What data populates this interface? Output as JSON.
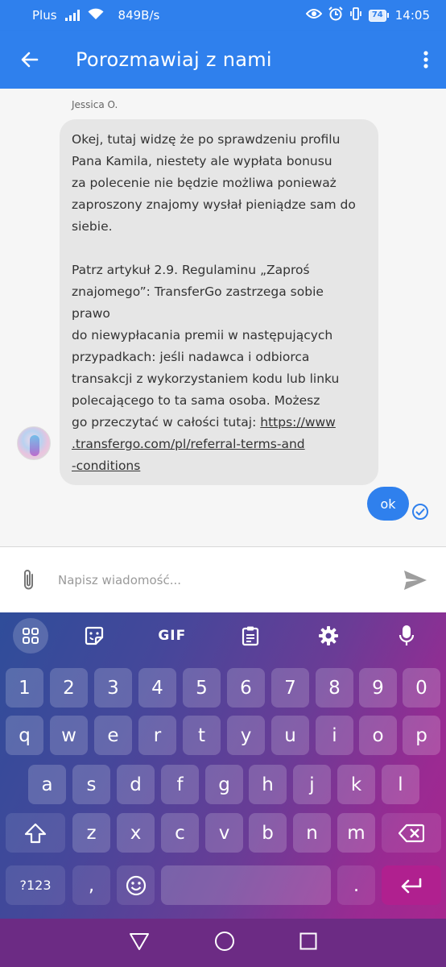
{
  "status_bar": {
    "carrier": "Plus",
    "speed": "849B/s",
    "battery": "74",
    "time": "14:05"
  },
  "app_bar": {
    "title": "Porozmawiaj z nami"
  },
  "chat": {
    "agent_name": "Jessica O.",
    "agent_message": "Okej, tutaj widzę że po sprawdzeniu profilu\nPana Kamila, niestety ale wypłata bonusu\nza polecenie nie będzie możliwa ponieważ\nzaproszony znajomy wysłał pieniądze sam do\nsiebie.\n\nPatrz artykuł 2.9. Regulaminu „Zaproś\nznajomego”: TransferGo zastrzega sobie prawo\ndo niewypłacania premii w następujących\nprzypadkach: jeśli nadawca i odbiorca\ntransakcji z wykorzystaniem kodu lub linku\npolecającego to ta sama osoba. Możesz\ngo przeczytać w całości tutaj: ",
    "agent_link": "https://www\n.transfergo.com/pl/referral-terms-and\n-conditions",
    "user_message": "ok"
  },
  "composer": {
    "placeholder": "Napisz wiadomość..."
  },
  "keyboard": {
    "toolbar": {
      "gif_label": "GIF"
    },
    "number_row": [
      "1",
      "2",
      "3",
      "4",
      "5",
      "6",
      "7",
      "8",
      "9",
      "0"
    ],
    "row1": [
      "q",
      "w",
      "e",
      "r",
      "t",
      "y",
      "u",
      "i",
      "o",
      "p"
    ],
    "row2": [
      "a",
      "s",
      "d",
      "f",
      "g",
      "h",
      "j",
      "k",
      "l"
    ],
    "row3": [
      "z",
      "x",
      "c",
      "v",
      "b",
      "n",
      "m"
    ],
    "bottom": {
      "symbols_label": "?123",
      "comma": ",",
      "period": "."
    }
  },
  "colors": {
    "primary": "#2f80ed",
    "bubble_incoming": "#e6e6e6",
    "nav_bar": "#6c2b84"
  }
}
